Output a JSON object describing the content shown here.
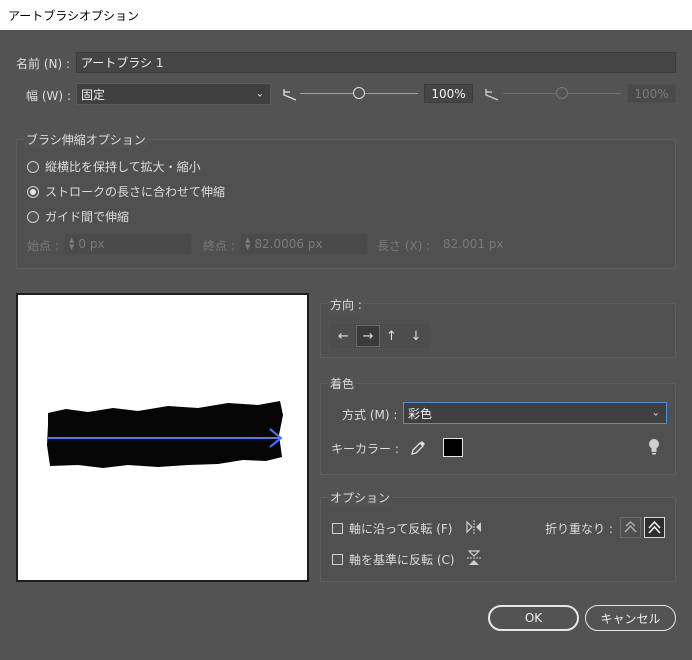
{
  "window": {
    "title": "アートブラシオプション"
  },
  "name_field": {
    "label": "名前 (N) :",
    "value": "アートブラシ 1"
  },
  "width": {
    "label": "幅 (W) :",
    "select_value": "固定",
    "percent_value": "100%",
    "percent_value_disabled": "100%"
  },
  "stretch_options": {
    "title": "ブラシ伸縮オプション",
    "options": [
      {
        "label": "縦横比を保持して拡大・縮小",
        "checked": false
      },
      {
        "label": "ストロークの長さに合わせて伸縮",
        "checked": true
      },
      {
        "label": "ガイド間で伸縮",
        "checked": false
      }
    ],
    "start_label": "始点 :",
    "start_value": "0 px",
    "end_label": "終点 :",
    "end_value": "82.0006 px",
    "length_label": "長さ (X) :",
    "length_value": "82.001 px"
  },
  "direction": {
    "title": "方向 :",
    "buttons": [
      "←",
      "→",
      "↑",
      "↓"
    ],
    "active_index": 1
  },
  "colorization": {
    "title": "着色",
    "method_label": "方式 (M) :",
    "method_value": "彩色",
    "key_color_label": "キーカラー :",
    "key_color": "#000000"
  },
  "options": {
    "title": "オプション",
    "flip_along_label": "軸に沿って反転 (F)",
    "flip_across_label": "軸を基準に反転 (C)",
    "overlap_label": "折り重なり :"
  },
  "buttons": {
    "ok": "OK",
    "cancel": "キャンセル"
  },
  "colors": {
    "background": "#535353",
    "accent_arrow": "#4a7cff",
    "focus_border": "#4f8fd6"
  }
}
